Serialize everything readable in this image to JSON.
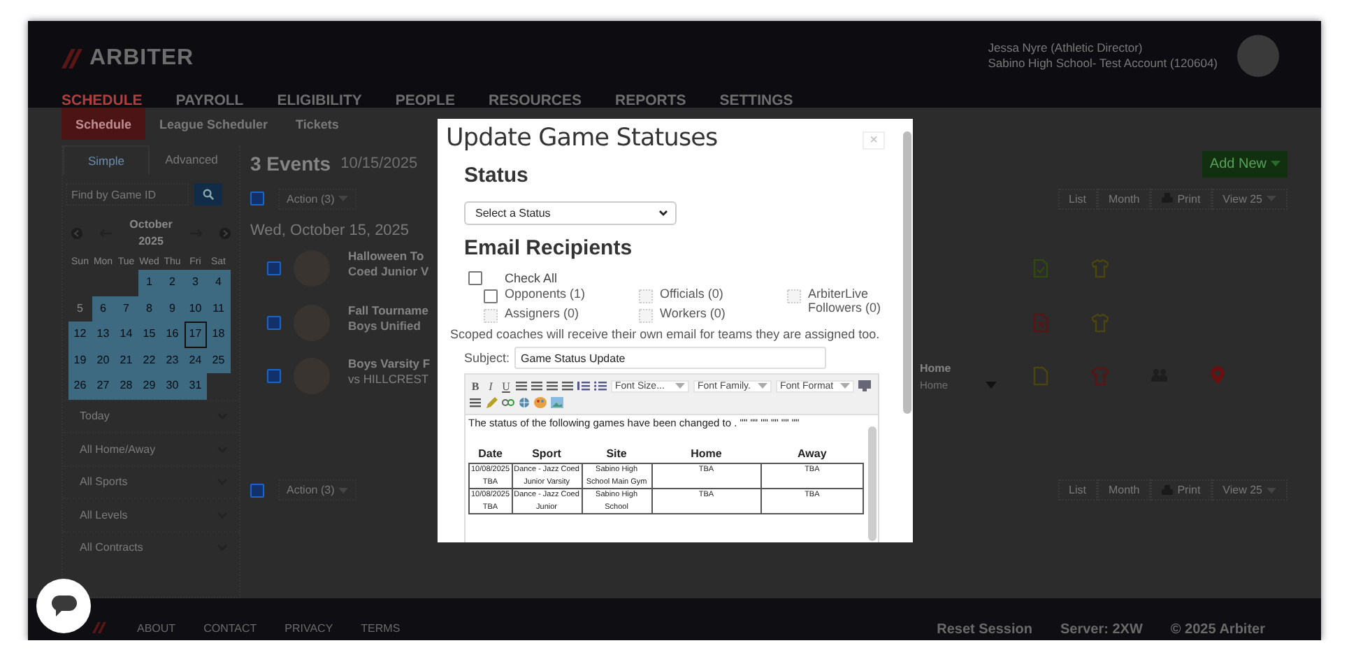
{
  "header": {
    "logo": "ARBITER",
    "nav": [
      {
        "label": "SCHEDULE",
        "selected": true
      },
      {
        "label": "PAYROLL",
        "selected": false
      },
      {
        "label": "ELIGIBILITY",
        "selected": false
      },
      {
        "label": "PEOPLE",
        "selected": false
      },
      {
        "label": "RESOURCES",
        "selected": false
      },
      {
        "label": "REPORTS",
        "selected": false
      },
      {
        "label": "SETTINGS",
        "selected": false
      }
    ],
    "user": "Jessa Nyre (Athletic Director)",
    "account": "Sabino High School- Test Account (120604)"
  },
  "subtabs": [
    {
      "label": "Schedule",
      "selected": true
    },
    {
      "label": "League Scheduler",
      "selected": false
    },
    {
      "label": "Tickets",
      "selected": false
    }
  ],
  "sidebar": {
    "tabs": [
      {
        "label": "Simple",
        "selected": true
      },
      {
        "label": "Advanced",
        "selected": false
      }
    ],
    "search": {
      "placeholder": "Find by Game ID"
    },
    "calendar": {
      "month": "October",
      "year": "2025",
      "weekdays": [
        "Sun",
        "Mon",
        "Tue",
        "Wed",
        "Thu",
        "Fri",
        "Sat"
      ],
      "weeks": [
        [
          {
            "day": "1",
            "in_range": true,
            "today": false
          },
          {
            "day": "2",
            "in_range": true,
            "today": false
          },
          {
            "day": "3",
            "in_range": true,
            "today": false
          },
          {
            "day": "4",
            "in_range": true,
            "today": false
          }
        ],
        [
          {
            "day": "5",
            "in_range": false,
            "today": false
          },
          {
            "day": "6",
            "in_range": true,
            "today": false
          },
          {
            "day": "7",
            "in_range": true,
            "today": false
          },
          {
            "day": "8",
            "in_range": true,
            "today": false
          },
          {
            "day": "9",
            "in_range": true,
            "today": false
          },
          {
            "day": "10",
            "in_range": true,
            "today": false
          },
          {
            "day": "11",
            "in_range": true,
            "today": false
          }
        ],
        [
          {
            "day": "12",
            "in_range": true,
            "today": false
          },
          {
            "day": "13",
            "in_range": true,
            "today": false
          },
          {
            "day": "14",
            "in_range": true,
            "today": false
          },
          {
            "day": "15",
            "in_range": true,
            "today": false
          },
          {
            "day": "16",
            "in_range": true,
            "today": false
          },
          {
            "day": "17",
            "in_range": true,
            "today": true
          },
          {
            "day": "18",
            "in_range": true,
            "today": false
          }
        ],
        [
          {
            "day": "19",
            "in_range": true,
            "today": false
          },
          {
            "day": "20",
            "in_range": true,
            "today": false
          },
          {
            "day": "21",
            "in_range": true,
            "today": false
          },
          {
            "day": "22",
            "in_range": true,
            "today": false
          },
          {
            "day": "23",
            "in_range": true,
            "today": false
          },
          {
            "day": "24",
            "in_range": true,
            "today": false
          },
          {
            "day": "25",
            "in_range": true,
            "today": false
          }
        ],
        [
          {
            "day": "26",
            "in_range": true,
            "today": false
          },
          {
            "day": "27",
            "in_range": true,
            "today": false
          },
          {
            "day": "28",
            "in_range": true,
            "today": false
          },
          {
            "day": "29",
            "in_range": true,
            "today": false
          },
          {
            "day": "30",
            "in_range": true,
            "today": false
          },
          {
            "day": "31",
            "in_range": true,
            "today": false
          }
        ]
      ]
    },
    "filters": [
      "Today",
      "All Home/Away",
      "All Sports",
      "All Levels",
      "All Contracts"
    ]
  },
  "events": {
    "count": "3 Events",
    "date": "10/15/2025",
    "add_new": "Add New",
    "action": "Action (3)",
    "all_checked": true,
    "views": [
      "List",
      "Month",
      "Print",
      "View 25"
    ],
    "day_heading": "Wed, October 15, 2025",
    "items": [
      {
        "title": "Halloween To",
        "subtitle": "Coed Junior V",
        "checked": true,
        "icons": [
          {
            "kind": "document-check",
            "color": "#2f4a10"
          },
          {
            "kind": "shirt",
            "color": "#4a4410"
          }
        ]
      },
      {
        "title": "Fall Tourname",
        "subtitle": "Boys Unified",
        "checked": true,
        "icons": [
          {
            "kind": "document-x",
            "color": "#5a1414"
          },
          {
            "kind": "shirt",
            "color": "#4a4410"
          }
        ]
      },
      {
        "title": "Boys Varsity F",
        "subtitle": "vs HILLCREST",
        "checked": true,
        "home": {
          "label": "Home",
          "placeholder": "Home"
        },
        "icons": [
          {
            "kind": "document",
            "color": "#4a4410"
          },
          {
            "kind": "shirt",
            "color": "#5a1414"
          },
          {
            "kind": "people",
            "color": "#1e1e1e"
          },
          {
            "kind": "pin",
            "color": "#6a1010"
          }
        ]
      }
    ],
    "bottom_action": "Action (3)",
    "bottom_all_checked": true,
    "bottom_views": [
      "List",
      "Month",
      "Print",
      "View 25"
    ]
  },
  "footer": {
    "links": [
      "ABOUT",
      "CONTACT",
      "PRIVACY",
      "TERMS"
    ],
    "reset": "Reset Session",
    "server": "Server: 2XW",
    "copyright": "© 2025 Arbiter"
  },
  "modal": {
    "title": "Update Game Statuses",
    "close": "×",
    "status_heading": "Status",
    "status_select": "Select a Status",
    "recipients_heading": "Email Recipients",
    "check_all": {
      "label": "Check All",
      "checked": false
    },
    "recipients": [
      {
        "label": "Opponents (1)",
        "checked": false,
        "disabled": false
      },
      {
        "label": "Officials (0)",
        "disabled": true
      },
      {
        "label": "ArbiterLive Followers (0)",
        "disabled": true
      },
      {
        "label": "Assigners (0)",
        "disabled": true
      },
      {
        "label": "Workers (0)",
        "disabled": true
      }
    ],
    "note": "Scoped coaches will receive their own email for teams they are assigned too.",
    "subject_label": "Subject:",
    "subject": "Game Status Update",
    "toolbar": {
      "bold": "B",
      "italic": "I",
      "underline": "U",
      "font_size": "Font Size...",
      "font_family": "Font Family.",
      "font_format": "Font Format"
    },
    "body_text": "The status of the following games have been changed to . \"\" \"\" \"\" \"\" \"\" \"\"",
    "table": {
      "columns": [
        "Date",
        "Sport",
        "Site",
        "Home",
        "Away"
      ],
      "rows": [
        [
          "10/08/2025 TBA",
          "Dance - Jazz Coed Junior Varsity",
          "Sabino High School Main Gym",
          "TBA",
          "TBA"
        ],
        [
          "10/08/2025 TBA",
          "Dance - Jazz Coed Junior",
          "Sabino High School",
          "TBA",
          "TBA"
        ]
      ]
    }
  }
}
